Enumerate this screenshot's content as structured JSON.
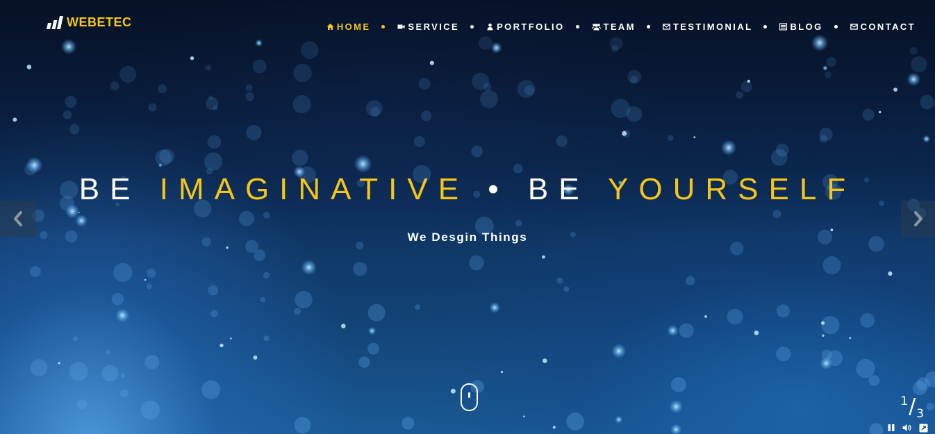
{
  "logo": {
    "text": "WEBETEC"
  },
  "nav": {
    "items": [
      {
        "label": "HOME",
        "icon": "home-icon",
        "active": true
      },
      {
        "label": "SERVICE",
        "icon": "video-camera-icon",
        "active": false
      },
      {
        "label": "PORTFOLIO",
        "icon": "user-icon",
        "active": false
      },
      {
        "label": "TEAM",
        "icon": "users-icon",
        "active": false
      },
      {
        "label": "TESTIMONIAL",
        "icon": "envelope-icon",
        "active": false
      },
      {
        "label": "BLOG",
        "icon": "list-icon",
        "active": false
      },
      {
        "label": "CONTACT",
        "icon": "envelope-icon",
        "active": false
      }
    ]
  },
  "hero": {
    "headline_part1": "BE ",
    "headline_part2": "IMAGINATIVE",
    "headline_part3": " • BE ",
    "headline_part4": "YOURSELF",
    "subheadline": "We Desgin Things"
  },
  "slider": {
    "current": "1",
    "separator": "/",
    "total": "3",
    "prev_icon": "chevron-left-icon",
    "next_icon": "chevron-right-icon"
  },
  "video_controls": {
    "pause_icon": "pause-icon",
    "volume_icon": "volume-icon",
    "fullscreen_icon": "fullscreen-icon"
  },
  "colors": {
    "accent": "#f5c518",
    "text": "#ffffff",
    "background_dark": "#0b1f3f",
    "background_light": "#1a5a94"
  }
}
